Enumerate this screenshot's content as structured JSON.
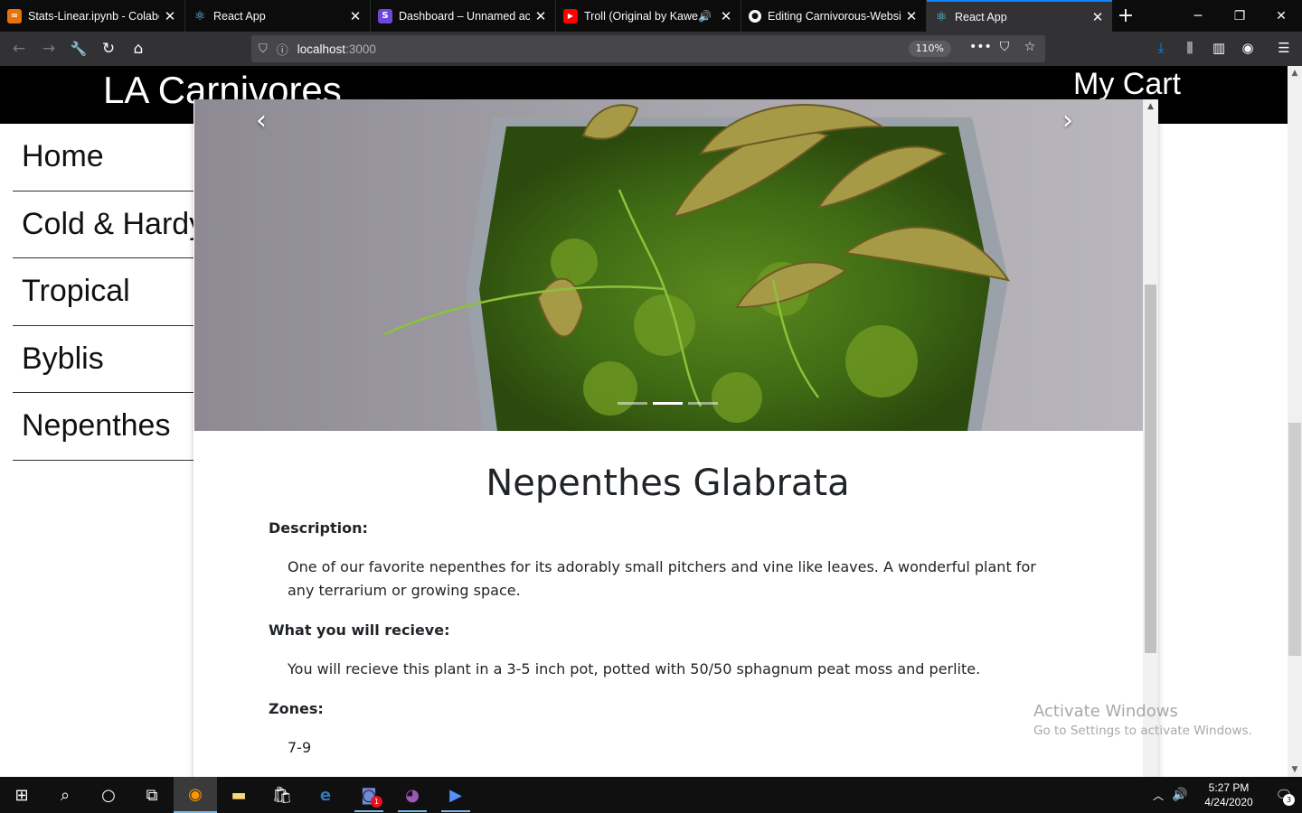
{
  "browser": {
    "tabs": [
      {
        "label": "Stats-Linear.ipynb - Colabo",
        "favicon_color": "#e8710a",
        "favicon": "∞"
      },
      {
        "label": "React App",
        "favicon_color": "#61dafb",
        "favicon": "⚛"
      },
      {
        "label": "Dashboard – Unnamed acc",
        "favicon_color": "#6b47dc",
        "favicon": "S"
      },
      {
        "label": "Troll (Original by Kaweh",
        "favicon_color": "#ff0000",
        "favicon": "▶"
      },
      {
        "label": "Editing Carnivorous-Websi",
        "favicon_color": "#f9f9fa",
        "favicon": "●"
      },
      {
        "label": "React App",
        "favicon_color": "#61dafb",
        "favicon": "⚛"
      }
    ],
    "active_tab": 5,
    "url_host": "localhost",
    "url_port": ":3000",
    "zoom": "110%",
    "accent_color": "#0a84ff"
  },
  "site": {
    "brand": "LA Carnivores",
    "cart": "My Cart",
    "nav": [
      "Home",
      "Cold & Hardy",
      "Tropical",
      "Byblis",
      "Nepenthes"
    ]
  },
  "product": {
    "title": "Nepenthes Glabrata",
    "description_label": "Description:",
    "description": "One of our favorite nepenthes for its adorably small pitchers and vine like leaves. A wonderful plant for any terrarium or growing space.",
    "receive_label": "What you will recieve:",
    "receive": "You will recieve this plant in a 3-5 inch pot, potted with 50/50 sphagnum peat moss and perlite.",
    "zones_label": "Zones:",
    "zones": "7-9",
    "carousel_slides": 3,
    "carousel_active": 1
  },
  "watermark": {
    "line1": "Activate Windows",
    "line2": "Go to Settings to activate Windows."
  },
  "taskbar": {
    "time": "5:27 PM",
    "date": "4/24/2020",
    "discord_badge": "1",
    "notification_count": "3"
  }
}
